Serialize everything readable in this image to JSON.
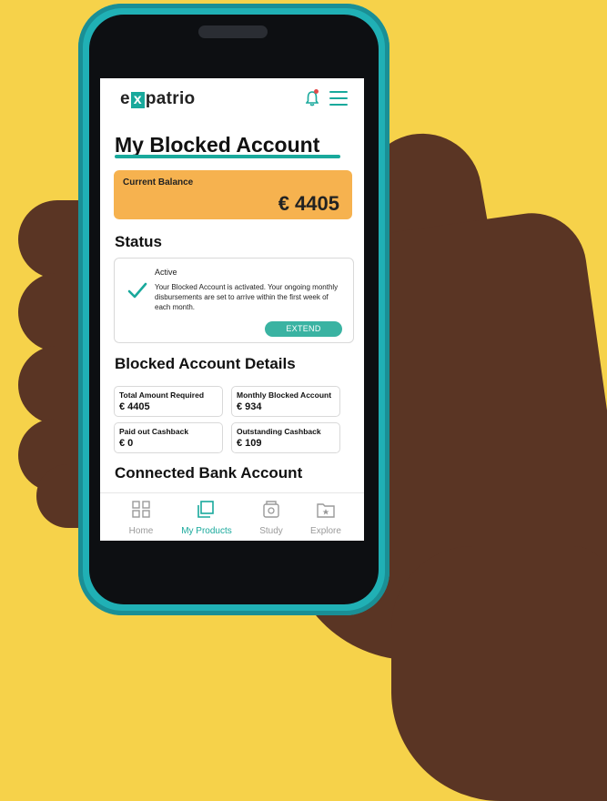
{
  "app": {
    "logo_prefix": "e",
    "logo_x": "x",
    "logo_suffix": "patrio"
  },
  "page": {
    "title": "My Blocked Account"
  },
  "balance": {
    "label": "Current Balance",
    "value": "€ 4405"
  },
  "status": {
    "section_title": "Status",
    "state": "Active",
    "description": "Your Blocked Account is activated. Your ongoing monthly disbursements are set to arrive within the first week of each month.",
    "extend_label": "EXTEND"
  },
  "details": {
    "section_title": "Blocked Account Details",
    "items": [
      {
        "label": "Total Amount Required",
        "value": "€ 4405"
      },
      {
        "label": "Monthly Blocked Account",
        "value": "€ 934"
      },
      {
        "label": "Paid out Cashback",
        "value": "€ 0"
      },
      {
        "label": "Outstanding Cashback",
        "value": "€ 109"
      }
    ]
  },
  "connected": {
    "section_title": "Connected Bank Account"
  },
  "nav": {
    "items": [
      {
        "label": "Home",
        "icon": "grid-icon"
      },
      {
        "label": "My Products",
        "icon": "layers-icon"
      },
      {
        "label": "Study",
        "icon": "study-icon"
      },
      {
        "label": "Explore",
        "icon": "folder-star-icon"
      }
    ]
  },
  "colors": {
    "background": "#f6d24a",
    "phone_case": "#20b0b5",
    "accent": "#19a99c",
    "balance_card": "#f6b24f"
  }
}
